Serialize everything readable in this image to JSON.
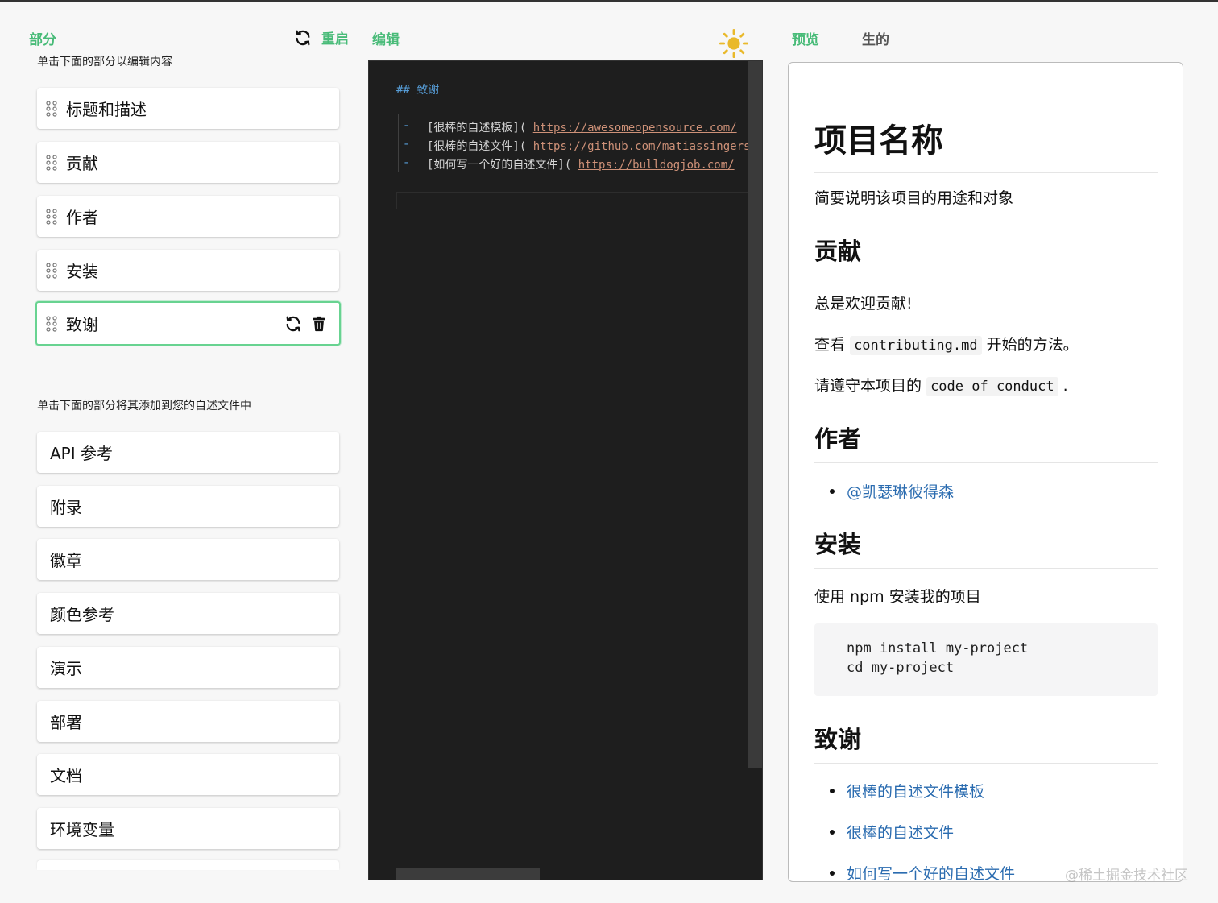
{
  "sections": {
    "title": "部分",
    "reset_label": "重启",
    "edit_hint": "单击下面的部分以编辑内容",
    "add_hint": "单击下面的部分将其添加到您的自述文件中",
    "selected": [
      "标题和描述",
      "贡献",
      "作者",
      "安装",
      "致谢"
    ],
    "available": [
      "API 参考",
      "附录",
      "徽章",
      "颜色参考",
      "演示",
      "部署",
      "文档",
      "环境变量"
    ]
  },
  "editor": {
    "title": "编辑",
    "heading_line": "## 致谢",
    "links": [
      {
        "text": "[很棒的自述模板](",
        "url": "https://awesomeopensource.com/"
      },
      {
        "text": "[很棒的自述文件](",
        "url": "https://github.com/matiassingers"
      },
      {
        "text": "[如何写一个好的自述文件](",
        "url": "https://bulldogjob.com/"
      }
    ]
  },
  "preview": {
    "tab_preview": "预览",
    "tab_raw": "生的",
    "project_title": "项目名称",
    "project_desc": "简要说明该项目的用途和对象",
    "contrib_heading": "贡献",
    "contrib_welcome": "总是欢迎贡献!",
    "contrib_see": "查看",
    "contrib_file": "contributing.md",
    "contrib_start": "开始的方法。",
    "contrib_follow": "请遵守本项目的",
    "contrib_code": "code of conduct",
    "contrib_period": ".",
    "authors_heading": "作者",
    "author_link": "@凯瑟琳彼得森",
    "install_heading": "安装",
    "install_text": "使用 npm 安装我的项目",
    "install_code_1": "npm install my-project",
    "install_code_2": "cd my-project",
    "ack_heading": "致谢",
    "ack_links": [
      "很棒的自述文件模板",
      "很棒的自述文件",
      "如何写一个好的自述文件"
    ]
  },
  "watermark": "@稀土掘金技术社区",
  "colors": {
    "accent": "#48bb78",
    "active_border": "#68d391",
    "link": "#2b6cb0",
    "editor_bg": "#1e1e1e"
  },
  "icons": [
    "refresh-icon",
    "drag-handle-icon",
    "trash-icon",
    "sun-icon"
  ]
}
